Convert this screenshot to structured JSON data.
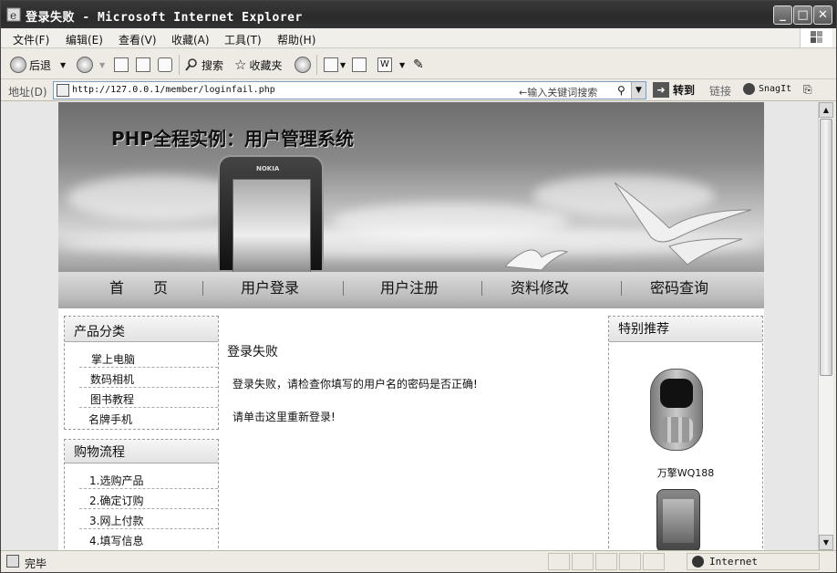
{
  "window": {
    "title": "登录失败 - Microsoft Internet Explorer",
    "minimize": "_",
    "maximize": "□",
    "close": "✕"
  },
  "menu": [
    "文件(F)",
    "编辑(E)",
    "查看(V)",
    "收藏(A)",
    "工具(T)",
    "帮助(H)"
  ],
  "toolbar": {
    "back": "后退",
    "search": "搜索",
    "favorites": "收藏夹"
  },
  "address": {
    "label": "地址(D)",
    "url": "http://127.0.0.1/member/loginfail.php",
    "hint": "←输入关键词搜索",
    "go": "转到",
    "links": "链接",
    "snagit": "SnagIt"
  },
  "site": {
    "title": "PHP全程实例：用户管理系统",
    "phone_brand": "NOKIA",
    "nav": [
      "首　　页",
      "用户登录",
      "用户注册",
      "资料修改",
      "密码查询"
    ]
  },
  "left": {
    "categories_title": "产品分类",
    "categories": [
      "掌上电脑",
      "数码相机",
      "图书教程",
      "名牌手机"
    ],
    "flow_title": "购物流程",
    "flow": [
      "1.选购产品",
      "2.确定订购",
      "3.网上付款",
      "4.填写信息"
    ]
  },
  "main": {
    "title": "登录失败",
    "message": "登录失败，请检查你填写的用户名的密码是否正确!",
    "link_prefix": "请单击",
    "link_text": "这里",
    "link_suffix": "重新登录!"
  },
  "right": {
    "title": "特别推荐",
    "product1": "万擎WQ188"
  },
  "status": {
    "text": "完毕",
    "zone": "Internet"
  }
}
